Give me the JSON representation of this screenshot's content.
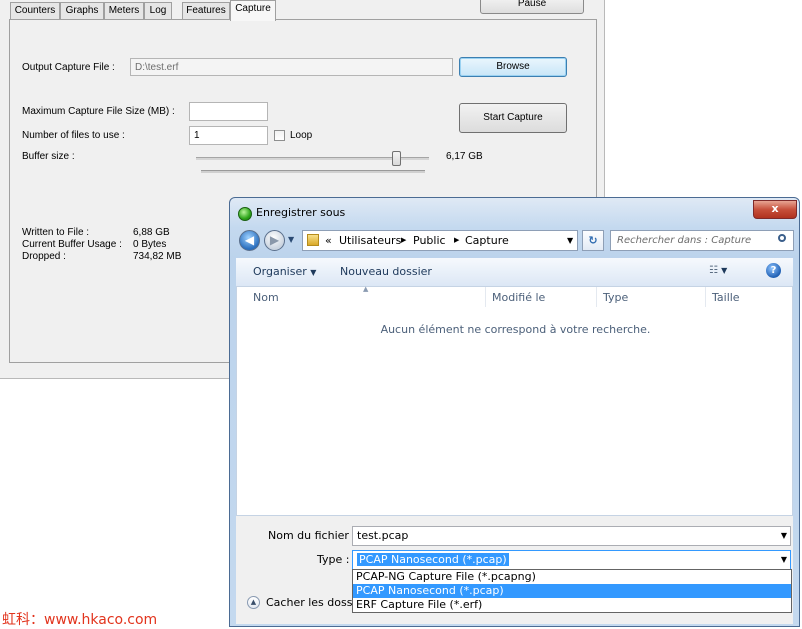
{
  "app": {
    "tabs": [
      "Counters",
      "Graphs",
      "Meters",
      "Log",
      "Features",
      "Capture"
    ],
    "active_tab": "Capture",
    "pause_label": "Pause",
    "output_label": "Output Capture File :",
    "output_value": "D:\\test.erf",
    "browse_label": "Browse",
    "max_size_label": "Maximum Capture File Size (MB) :",
    "max_size_value": "",
    "files_label": "Number of files to use :",
    "files_value": "1",
    "loop_label": "Loop",
    "loop_checked": false,
    "buffer_label": "Buffer size :",
    "buffer_value": "6,17 GB",
    "buffer_slider_fraction": 0.86,
    "start_label": "Start Capture",
    "stats": [
      {
        "label": "Written to File :",
        "value": "6,88 GB"
      },
      {
        "label": "Current Buffer Usage :",
        "value": "0 Bytes"
      },
      {
        "label": "Dropped :",
        "value": "734,82 MB"
      }
    ]
  },
  "dialog": {
    "title": "Enregistrer sous",
    "close_glyph": "x",
    "breadcrumb_prefix": "«",
    "breadcrumb": [
      "Utilisateurs",
      "Public",
      "Capture"
    ],
    "search_placeholder": "Rechercher dans : Capture",
    "toolbar": {
      "organize": "Organiser",
      "new_folder": "Nouveau dossier"
    },
    "columns": [
      "Nom",
      "Modifié le",
      "Type",
      "Taille"
    ],
    "empty_message": "Aucun élément ne correspond à votre recherche.",
    "filename_label": "Nom du fichier :",
    "filename_value": "test.pcap",
    "type_label": "Type :",
    "type_value": "PCAP Nanosecond (*.pcap)",
    "type_options": [
      "PCAP-NG Capture File (*.pcapng)",
      "PCAP Nanosecond (*.pcap)",
      "ERF Capture File (*.erf)"
    ],
    "type_selected_index": 1,
    "hide_folders_label": "Cacher les dossiers"
  },
  "watermark": "虹科：www.hkaco.com",
  "colors": {
    "selection": "#3399ff",
    "dialog_frame": "#c4d9ef",
    "close_red": "#c7503b",
    "watermark": "#e2341d"
  }
}
